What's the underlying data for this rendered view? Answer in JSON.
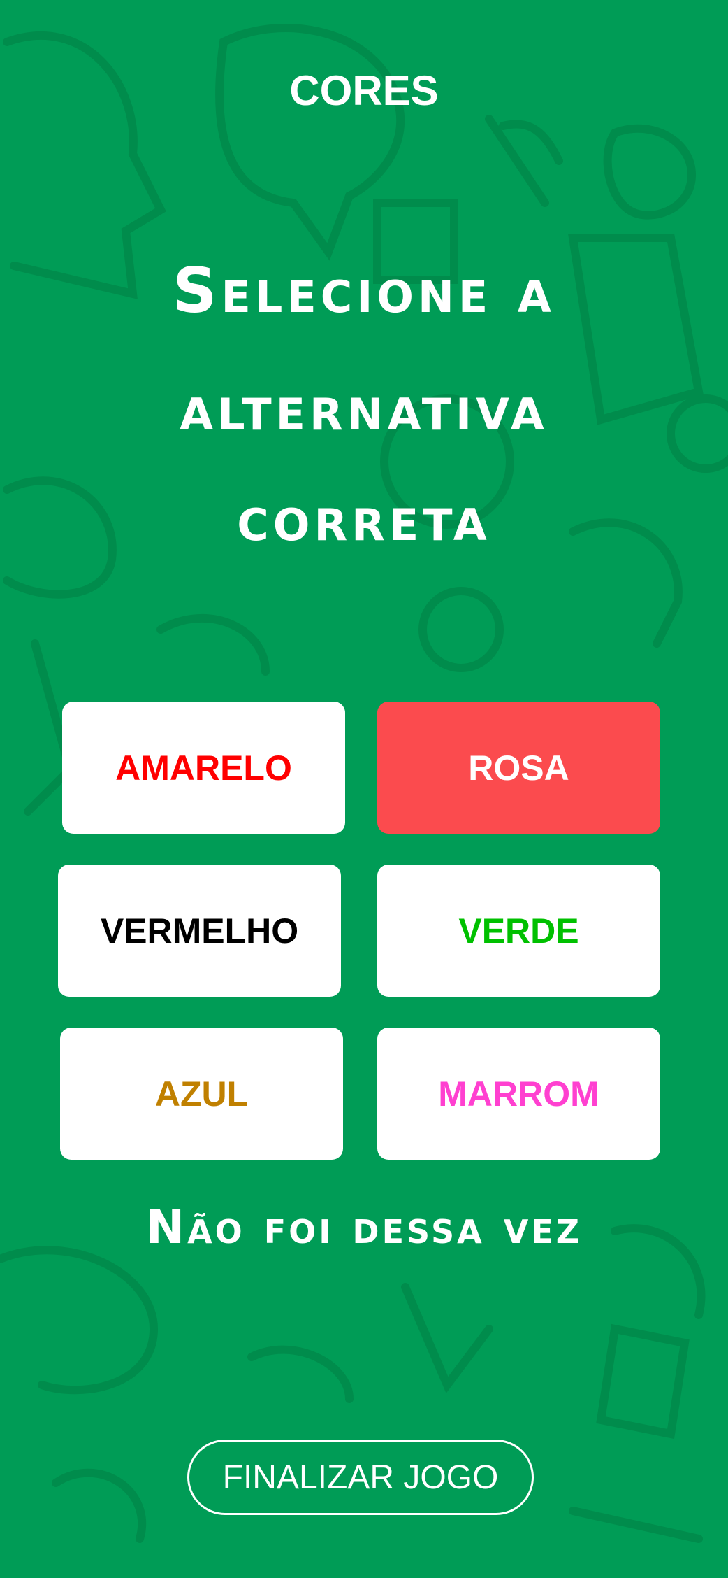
{
  "header": {
    "title": "CORES"
  },
  "question": {
    "lines": [
      "Selecione a",
      "alternativa",
      "correta"
    ]
  },
  "options": [
    {
      "label": "AMARELO",
      "color": "#ff0000",
      "selected": false
    },
    {
      "label": "ROSA",
      "color": "#ffffff",
      "selected": true
    },
    {
      "label": "VERMELHO",
      "color": "#000000",
      "selected": false
    },
    {
      "label": "VERDE",
      "color": "#00c000",
      "selected": false
    },
    {
      "label": "AZUL",
      "color": "#c08000",
      "selected": false
    },
    {
      "label": "MARROM",
      "color": "#ff40d0",
      "selected": false
    }
  ],
  "feedback": "Não foi dessa vez",
  "finish_button": "FINALIZAR JOGO",
  "colors": {
    "background": "#009c56",
    "selected_option": "#fb4b4e"
  }
}
